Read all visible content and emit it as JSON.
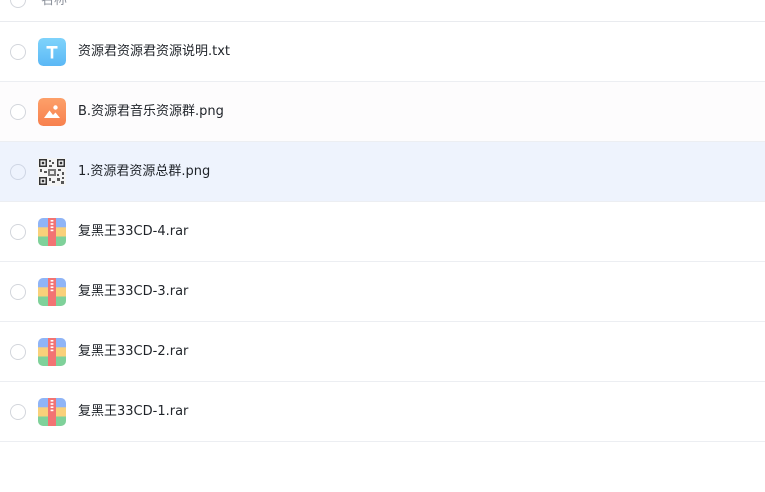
{
  "header": {
    "name_column_label": "名称"
  },
  "files": [
    {
      "name": "资源君资源君资源说明.txt",
      "icon": "txt-file-icon",
      "selected": false
    },
    {
      "name": "B.资源君音乐资源群.png",
      "icon": "image-file-icon",
      "selected": false
    },
    {
      "name": "1.资源君资源总群.png",
      "icon": "qr-code-thumbnail-icon",
      "selected": true
    },
    {
      "name": "复黑王33CD-4.rar",
      "icon": "archive-file-icon",
      "selected": false
    },
    {
      "name": "复黑王33CD-3.rar",
      "icon": "archive-file-icon",
      "selected": false
    },
    {
      "name": "复黑王33CD-2.rar",
      "icon": "archive-file-icon",
      "selected": false
    },
    {
      "name": "复黑王33CD-1.rar",
      "icon": "archive-file-icon",
      "selected": false
    }
  ],
  "colors": {
    "selected_row": "#eef3fd",
    "txt_icon": "#6cc6f8",
    "image_icon": "#fb8f5a"
  }
}
